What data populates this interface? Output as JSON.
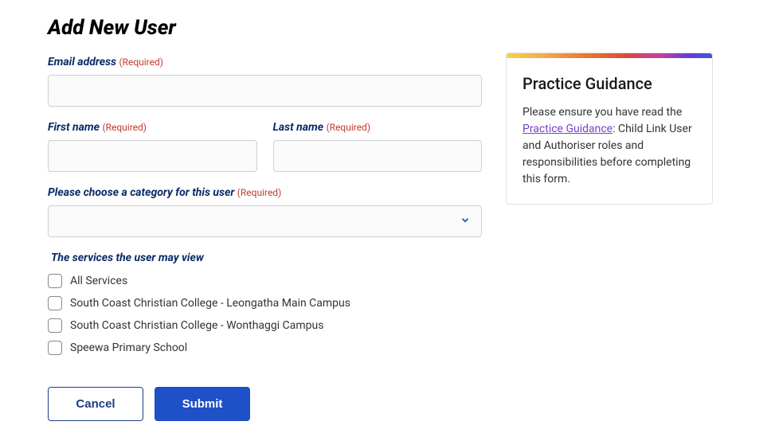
{
  "page": {
    "title": "Add New User"
  },
  "form": {
    "email": {
      "label": "Email address",
      "required": "(Required)",
      "value": ""
    },
    "first_name": {
      "label": "First name",
      "required": "(Required)",
      "value": ""
    },
    "last_name": {
      "label": "Last name",
      "required": "(Required)",
      "value": ""
    },
    "category": {
      "label": "Please choose a category for this user",
      "required": "(Required)",
      "selected": ""
    },
    "services": {
      "title": "The services the user may view",
      "items": [
        "All Services",
        "South Coast Christian College - Leongatha Main Campus",
        "South Coast Christian College - Wonthaggi Campus",
        "Speewa Primary School"
      ]
    },
    "buttons": {
      "cancel": "Cancel",
      "submit": "Submit"
    }
  },
  "guidance": {
    "title": "Practice Guidance",
    "text_before": "Please ensure you have read the ",
    "link_text": "Practice Guidance",
    "text_after": ": Child Link User and Authoriser roles and responsibilities before completing this form."
  }
}
